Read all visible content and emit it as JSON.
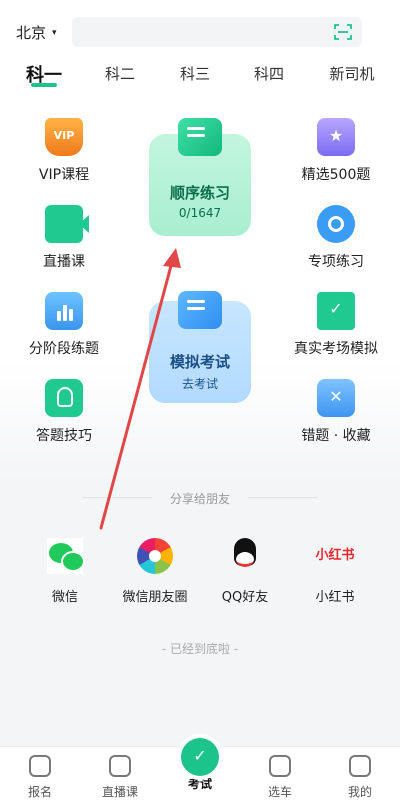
{
  "header": {
    "city": "北京",
    "city_caret": "▾"
  },
  "tabs": [
    {
      "label": "科一",
      "active": true
    },
    {
      "label": "科二"
    },
    {
      "label": "科三"
    },
    {
      "label": "科四"
    },
    {
      "label": "新司机"
    }
  ],
  "grid": {
    "left": [
      {
        "label": "VIP课程",
        "icon": "vip-icon",
        "badge": "VIP"
      },
      {
        "label": "直播课",
        "icon": "live-camera-icon"
      },
      {
        "label": "分阶段练题",
        "icon": "bar-chart-icon"
      },
      {
        "label": "答题技巧",
        "icon": "lightbulb-icon"
      }
    ],
    "right": [
      {
        "label": "精选500题",
        "icon": "star-icon",
        "glyph": "★"
      },
      {
        "label": "专项练习",
        "icon": "target-icon"
      },
      {
        "label": "真实考场模拟",
        "icon": "monitor-check-icon"
      },
      {
        "label": "错题 · 收藏",
        "icon": "error-card-icon"
      }
    ],
    "center": {
      "sequential": {
        "title": "顺序练习",
        "progress": "0/1647"
      },
      "mock": {
        "title": "模拟考试",
        "sub": "去考试"
      }
    }
  },
  "share": {
    "title": "分享给朋友",
    "items": [
      {
        "label": "微信",
        "icon": "wechat-icon"
      },
      {
        "label": "微信朋友圈",
        "icon": "moments-icon"
      },
      {
        "label": "QQ好友",
        "icon": "qq-icon"
      },
      {
        "label": "小红书",
        "icon": "xiaohongshu-icon",
        "logo_text": "小红书"
      }
    ]
  },
  "end_note": "- 已经到底啦 -",
  "nav": [
    {
      "label": "报名"
    },
    {
      "label": "直播课"
    },
    {
      "label": "考试",
      "active": true
    },
    {
      "label": "选车"
    },
    {
      "label": "我的"
    }
  ],
  "colors": {
    "accent": "#1cc48b",
    "arrow": "#e04848"
  }
}
